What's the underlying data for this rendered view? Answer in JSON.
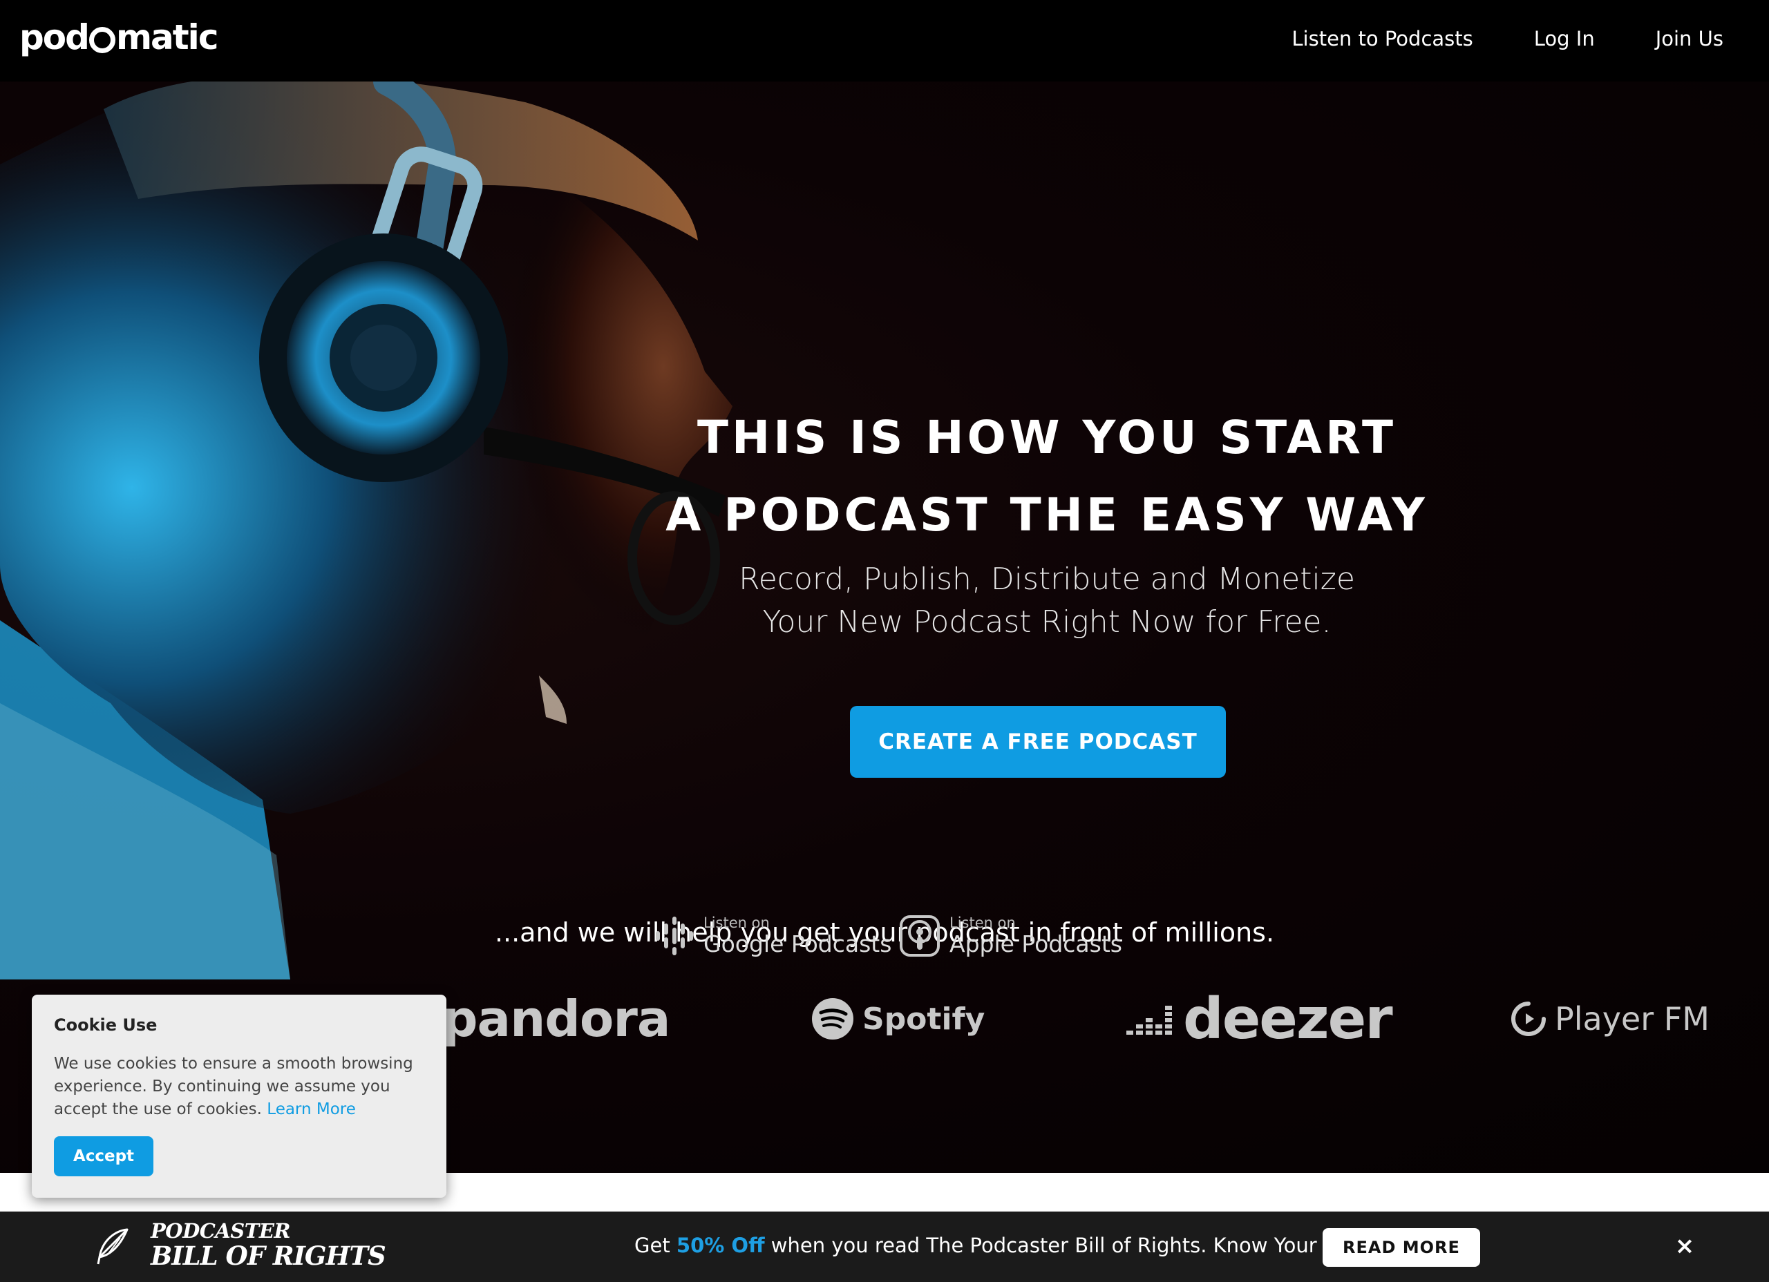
{
  "header": {
    "logo_text_pre": "pod",
    "logo_text_post": "matic",
    "nav": [
      {
        "label": "Listen to Podcasts"
      },
      {
        "label": "Log In"
      },
      {
        "label": "Join Us"
      }
    ]
  },
  "hero": {
    "title_line1": "THIS IS HOW YOU START",
    "title_line2": "A PODCAST THE EASY WAY",
    "subtitle_line1": "Record, Publish, Distribute and Monetize",
    "subtitle_line2": "Your New Podcast Right Now for Free.",
    "cta_label": "CREATE A FREE PODCAST",
    "tagline": "...and we will help you get your podcast in front of millions."
  },
  "badges": {
    "google": {
      "small": "Listen on",
      "big": "Google Podcasts"
    },
    "apple": {
      "small": "Listen on",
      "big": "Apple Podcasts"
    }
  },
  "platforms": {
    "pandora": "pandora",
    "spotify": "Spotify",
    "deezer": "deezer",
    "playerfm": "Player FM"
  },
  "cookie": {
    "title": "Cookie Use",
    "text": "We use cookies to ensure a smooth browsing experience. By continuing we assume you accept the use of cookies.",
    "link": "Learn More",
    "accept": "Accept"
  },
  "banner": {
    "title_line1": "PODCASTER",
    "title_line2": "BILL OF RIGHTS",
    "promo_pre": "Get",
    "promo_highlight": "50% Off",
    "promo_post": "when you read The Podcaster Bill of Rights. Know Your Rights.",
    "read_more": "READ MORE",
    "close": "×"
  },
  "colors": {
    "accent": "#0f9ce2",
    "background": "#000000",
    "banner": "#1b1b1b"
  },
  "icons": [
    "google-podcasts-icon",
    "apple-podcasts-icon",
    "spotify-icon",
    "deezer-icon",
    "playerfm-icon",
    "quill-icon",
    "close-icon"
  ]
}
